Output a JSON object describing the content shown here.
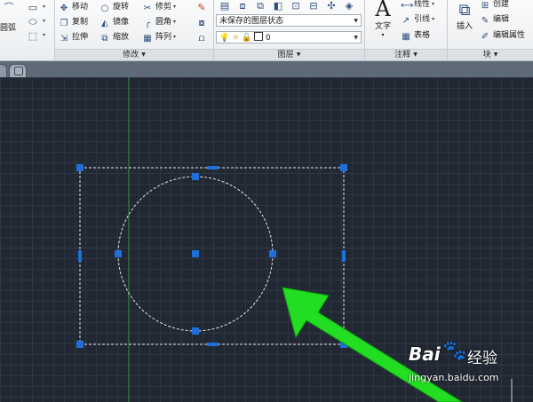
{
  "ribbon": {
    "draw_panel": {
      "arc_label": "圆弧"
    },
    "modify_panel": {
      "title": "修改",
      "tools": {
        "move": "移动",
        "rotate": "旋转",
        "trim": "修剪",
        "copy": "复制",
        "mirror": "镜像",
        "fillet": "圆角",
        "stretch": "拉伸",
        "scale": "缩放",
        "array": "阵列"
      }
    },
    "layers_panel": {
      "title": "图层",
      "layer_state": "未保存的图层状态",
      "current_layer": "0"
    },
    "annotation_panel": {
      "title": "注释",
      "text": "文字",
      "linear": "线性",
      "leader": "引线",
      "table": "表格",
      "text_glyph": "A"
    },
    "block_panel": {
      "title": "块",
      "insert": "插入",
      "create": "创建",
      "edit": "编辑",
      "edit_attributes": "编辑属性"
    }
  },
  "colors": {
    "viewport_bg": "#212833",
    "grip_blue": "#1e6fd9",
    "arrow_green": "#22dd22",
    "axis_green": "#2f8f3a"
  },
  "watermark": {
    "brand": "Bai",
    "brand_suffix": "经验",
    "url": "jingyan.baidu.com"
  }
}
